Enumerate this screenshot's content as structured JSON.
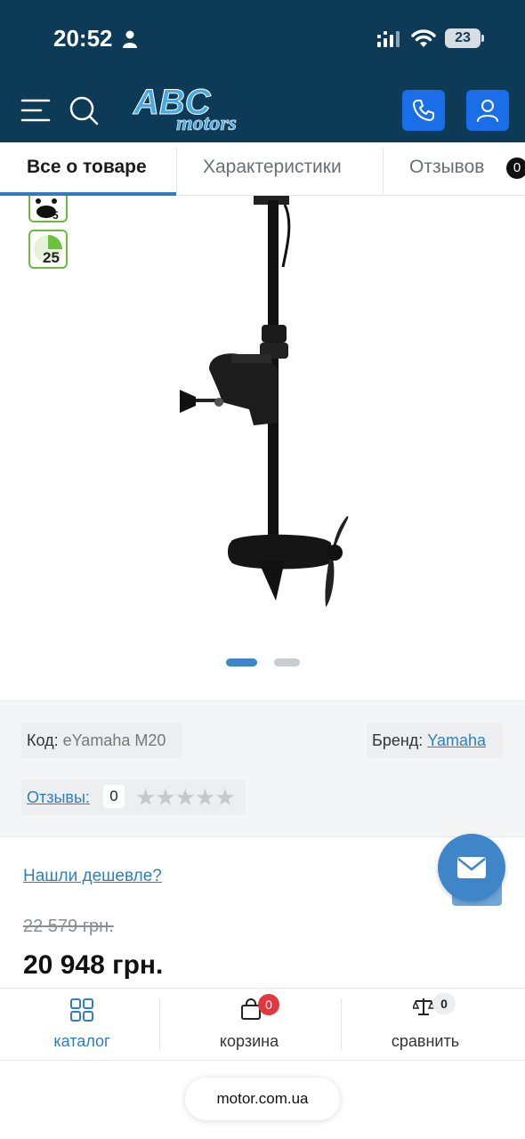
{
  "status_bar": {
    "time": "20:52",
    "battery": "23"
  },
  "header": {
    "logo_main": "ABC",
    "logo_sub": "motors",
    "menu_icon": "menu-icon",
    "search_icon": "search-icon",
    "phone_icon": "phone-icon",
    "user_icon": "user-icon",
    "accent": "#1a6fe8",
    "bg": "#0c3a57"
  },
  "tabs": [
    {
      "label": "Все о товаре",
      "active": true
    },
    {
      "label": "Характеристики",
      "active": false
    },
    {
      "label": "Отзывов",
      "active": false,
      "count": "0"
    }
  ],
  "gallery": {
    "badge_2_text": "25",
    "slides": 2,
    "active_slide": 1
  },
  "product": {
    "code_label": "Код:",
    "code_value": "eYamaha M20",
    "brand_label": "Бренд:",
    "brand_value": "Yamaha",
    "reviews_label": "Отзывы:",
    "reviews_count": "0",
    "rating_stars": "★★★★★",
    "rating": 0,
    "cheaper_link": "Нашли дешевле?",
    "old_price": "22 579 грн.",
    "price": "20 948 грн."
  },
  "bottom_nav": {
    "catalog": "каталог",
    "cart": "корзина",
    "cart_count": "0",
    "compare": "сравнить",
    "compare_count": "0"
  },
  "browser": {
    "url": "motor.com.ua"
  }
}
